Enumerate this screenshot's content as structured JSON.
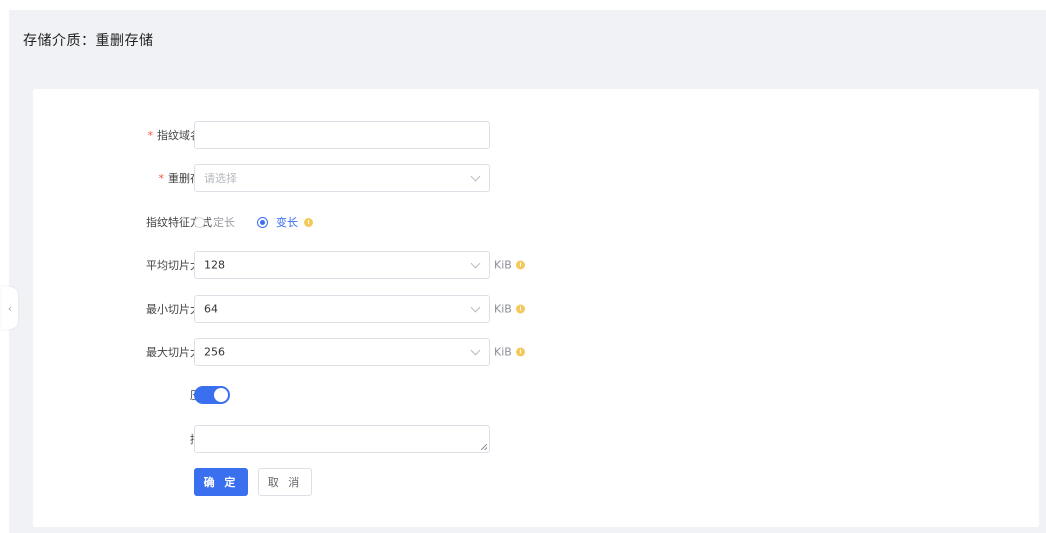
{
  "header": {
    "title": "存储介质：重删存储"
  },
  "form": {
    "fingerprint_domain": {
      "label": "指纹域名称",
      "required_mark": "*",
      "value": ""
    },
    "dedup_storage": {
      "label": "重删存储",
      "required_mark": "*",
      "placeholder": "请选择"
    },
    "fingerprint_mode": {
      "label": "指纹特征方式",
      "options": [
        {
          "label": "定长",
          "checked": false
        },
        {
          "label": "变长",
          "checked": true
        }
      ]
    },
    "avg_slice": {
      "label": "平均切片大小",
      "value": "128",
      "unit": "KiB"
    },
    "min_slice": {
      "label": "最小切片大小",
      "value": "64",
      "unit": "KiB"
    },
    "max_slice": {
      "label": "最大切片大小",
      "value": "256",
      "unit": "KiB"
    },
    "compress": {
      "label": "压缩",
      "enabled": true
    },
    "description": {
      "label": "描述",
      "value": ""
    }
  },
  "actions": {
    "confirm_label": "确 定",
    "cancel_label": "取 消"
  },
  "colors": {
    "primary": "#3a6ff0",
    "required": "#f5533d",
    "info": "#f3c95a",
    "page_bg": "#f1f2f5"
  },
  "icons": {
    "collapse": "chevron-left-icon",
    "dropdown": "chevron-down-icon",
    "info": "info-icon"
  }
}
